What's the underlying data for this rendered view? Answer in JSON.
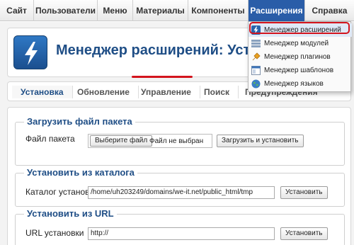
{
  "menu": {
    "items": [
      {
        "label": "Сайт"
      },
      {
        "label": "Пользователи"
      },
      {
        "label": "Меню"
      },
      {
        "label": "Материалы"
      },
      {
        "label": "Компоненты"
      },
      {
        "label": "Расширения"
      },
      {
        "label": "Справка"
      }
    ],
    "active_index": 5
  },
  "header": {
    "title": "Менеджер расширений: Установ"
  },
  "tabs": [
    {
      "label": "Установка"
    },
    {
      "label": "Обновление"
    },
    {
      "label": "Управление"
    },
    {
      "label": "Поиск"
    },
    {
      "label": "Предупреждения"
    }
  ],
  "sections": {
    "upload": {
      "legend": "Загрузить файл пакета",
      "label": "Файл пакета",
      "choose_button": "Выберите файл",
      "no_file": "Файл не выбран",
      "submit": "Загрузить и установить"
    },
    "directory": {
      "legend": "Установить из каталога",
      "label": "Каталог установки",
      "value": "/home/uh203249/domains/we-it.net/public_html/tmp",
      "submit": "Установить"
    },
    "url": {
      "legend": "Установить из URL",
      "label": "URL установки",
      "value": "http://",
      "submit": "Установить"
    }
  },
  "dropdown": {
    "items": [
      {
        "label": "Менеджер расширений",
        "icon": "lightning-icon"
      },
      {
        "label": "Менеджер модулей",
        "icon": "modules-icon"
      },
      {
        "label": "Менеджер плагинов",
        "icon": "plugin-icon"
      },
      {
        "label": "Менеджер шаблонов",
        "icon": "template-icon"
      },
      {
        "label": "Менеджер языков",
        "icon": "globe-icon"
      }
    ]
  },
  "colors": {
    "accent": "#1f4e86",
    "active_menu": "#2a5da8",
    "highlight": "#d3141d"
  }
}
